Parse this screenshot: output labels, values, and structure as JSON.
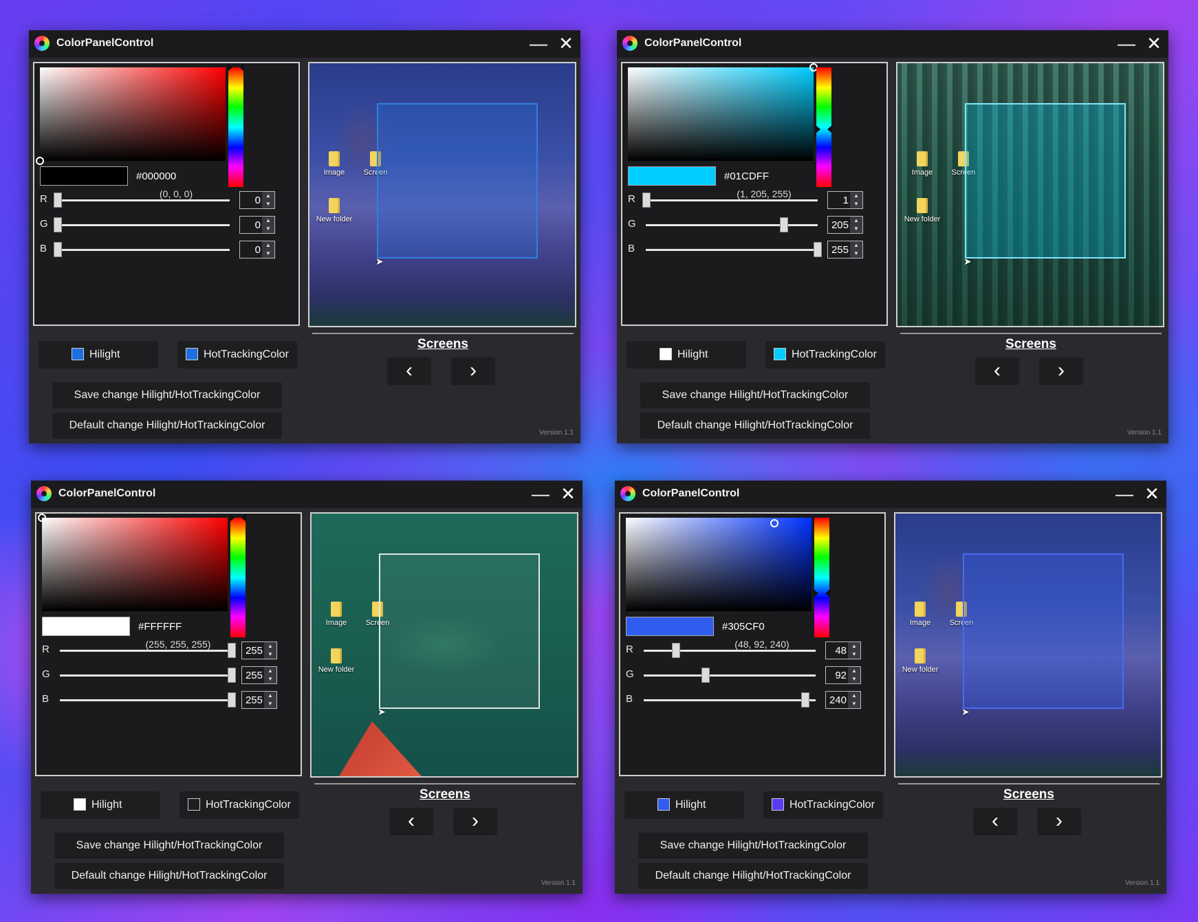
{
  "app_title": "ColorPanelControl",
  "titlebar": {
    "minimize_glyph": "—",
    "close_glyph": "✕"
  },
  "labels": {
    "screens": "Screens",
    "prev": "‹",
    "next": "›",
    "hilight": "Hilight",
    "hot_tracking": "HotTrackingColor",
    "save": "Save change Hilight/HotTrackingColor",
    "default": "Default change Hilight/HotTrackingColor",
    "version": "Version 1.1",
    "r": "R",
    "g": "G",
    "b": "B"
  },
  "desktop_icons": {
    "image": "Image",
    "screen": "Screen",
    "new_folder": "New folder"
  },
  "windows": [
    {
      "hue_color": "#ff0000",
      "hue_position": 0.0,
      "sv_marker": [
        0.0,
        1.0
      ],
      "swatch_color": "#000000",
      "hex": "#000000",
      "rgb_text": "(0, 0, 0)",
      "r": "0",
      "g": "0",
      "b": "0",
      "hilight_color": "#1e6fe0",
      "hot_tracking_color": "#1e6fe0",
      "selection_color": "rgba(30,120,230,0.25)",
      "selection_border": "#2f7fe0",
      "scene": "scene-town"
    },
    {
      "hue_color": "#00cdff",
      "hue_position": 0.52,
      "sv_marker": [
        1.0,
        0.0
      ],
      "swatch_color": "#01CDFF",
      "hex": "#01CDFF",
      "rgb_text": "(1, 205, 255)",
      "r": "1",
      "g": "205",
      "b": "255",
      "hilight_color": "#ffffff",
      "hot_tracking_color": "#01CDFF",
      "selection_color": "rgba(1,205,255,0.28)",
      "selection_border": "#7fe8ff",
      "scene": "scene-forest"
    },
    {
      "hue_color": "#ff0000",
      "hue_position": 0.0,
      "sv_marker": [
        0.0,
        0.0
      ],
      "swatch_color": "#FFFFFF",
      "hex": "#FFFFFF",
      "rgb_text": "(255, 255, 255)",
      "r": "255",
      "g": "255",
      "b": "255",
      "hilight_color": "#ffffff",
      "hot_tracking_color": "transparent",
      "selection_color": "rgba(255,255,255,0.06)",
      "selection_border": "#dfe8e4",
      "scene": "scene-green"
    },
    {
      "hue_color": "#0033ff",
      "hue_position": 0.63,
      "sv_marker": [
        0.8,
        0.06
      ],
      "swatch_color": "#305CF0",
      "hex": "#305CF0",
      "rgb_text": "(48, 92, 240)",
      "r": "48",
      "g": "92",
      "b": "240",
      "hilight_color": "#305CF0",
      "hot_tracking_color": "#5a3cf0",
      "selection_color": "rgba(48,92,240,0.3)",
      "selection_border": "#4a6af2",
      "scene": "scene-town"
    }
  ]
}
